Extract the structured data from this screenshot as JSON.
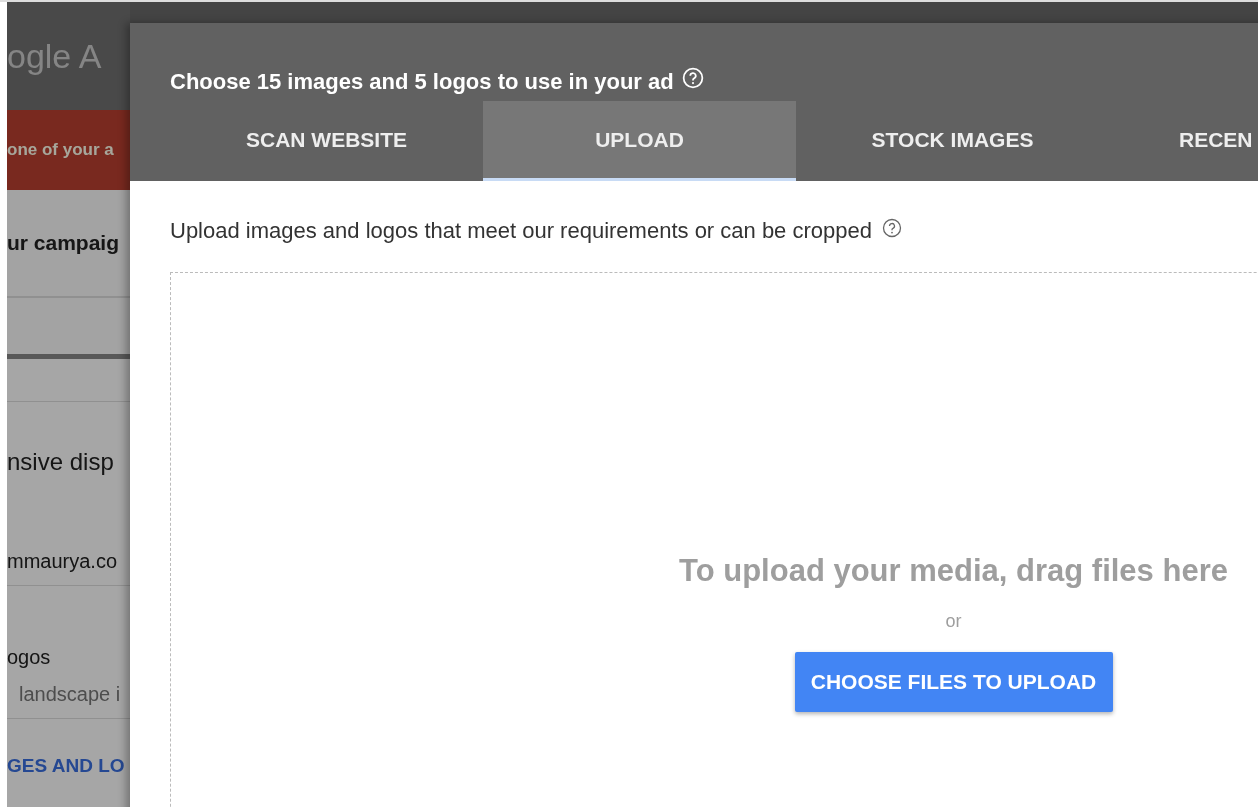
{
  "background_page": {
    "logo": "ogle A",
    "alert": "one of your a",
    "section_title": "ur campaig",
    "ad_type": "nsive disp",
    "website": "mmaurya.co",
    "assets_label": "ogos",
    "assets_hint": "landscape i",
    "assets_link": "GES AND LO"
  },
  "dialog": {
    "title": "Choose 15 images and 5 logos to use in your ad",
    "tabs": [
      {
        "label": "SCAN WEBSITE",
        "selected": false
      },
      {
        "label": "UPLOAD",
        "selected": true
      },
      {
        "label": "STOCK IMAGES",
        "selected": false
      },
      {
        "label": "RECEN",
        "selected": false
      }
    ],
    "instruction": "Upload images and logos that meet our requirements or can be cropped",
    "dropzone": {
      "heading": "To upload your media, drag files here",
      "or": "or",
      "button": "CHOOSE FILES TO UPLOAD"
    }
  }
}
